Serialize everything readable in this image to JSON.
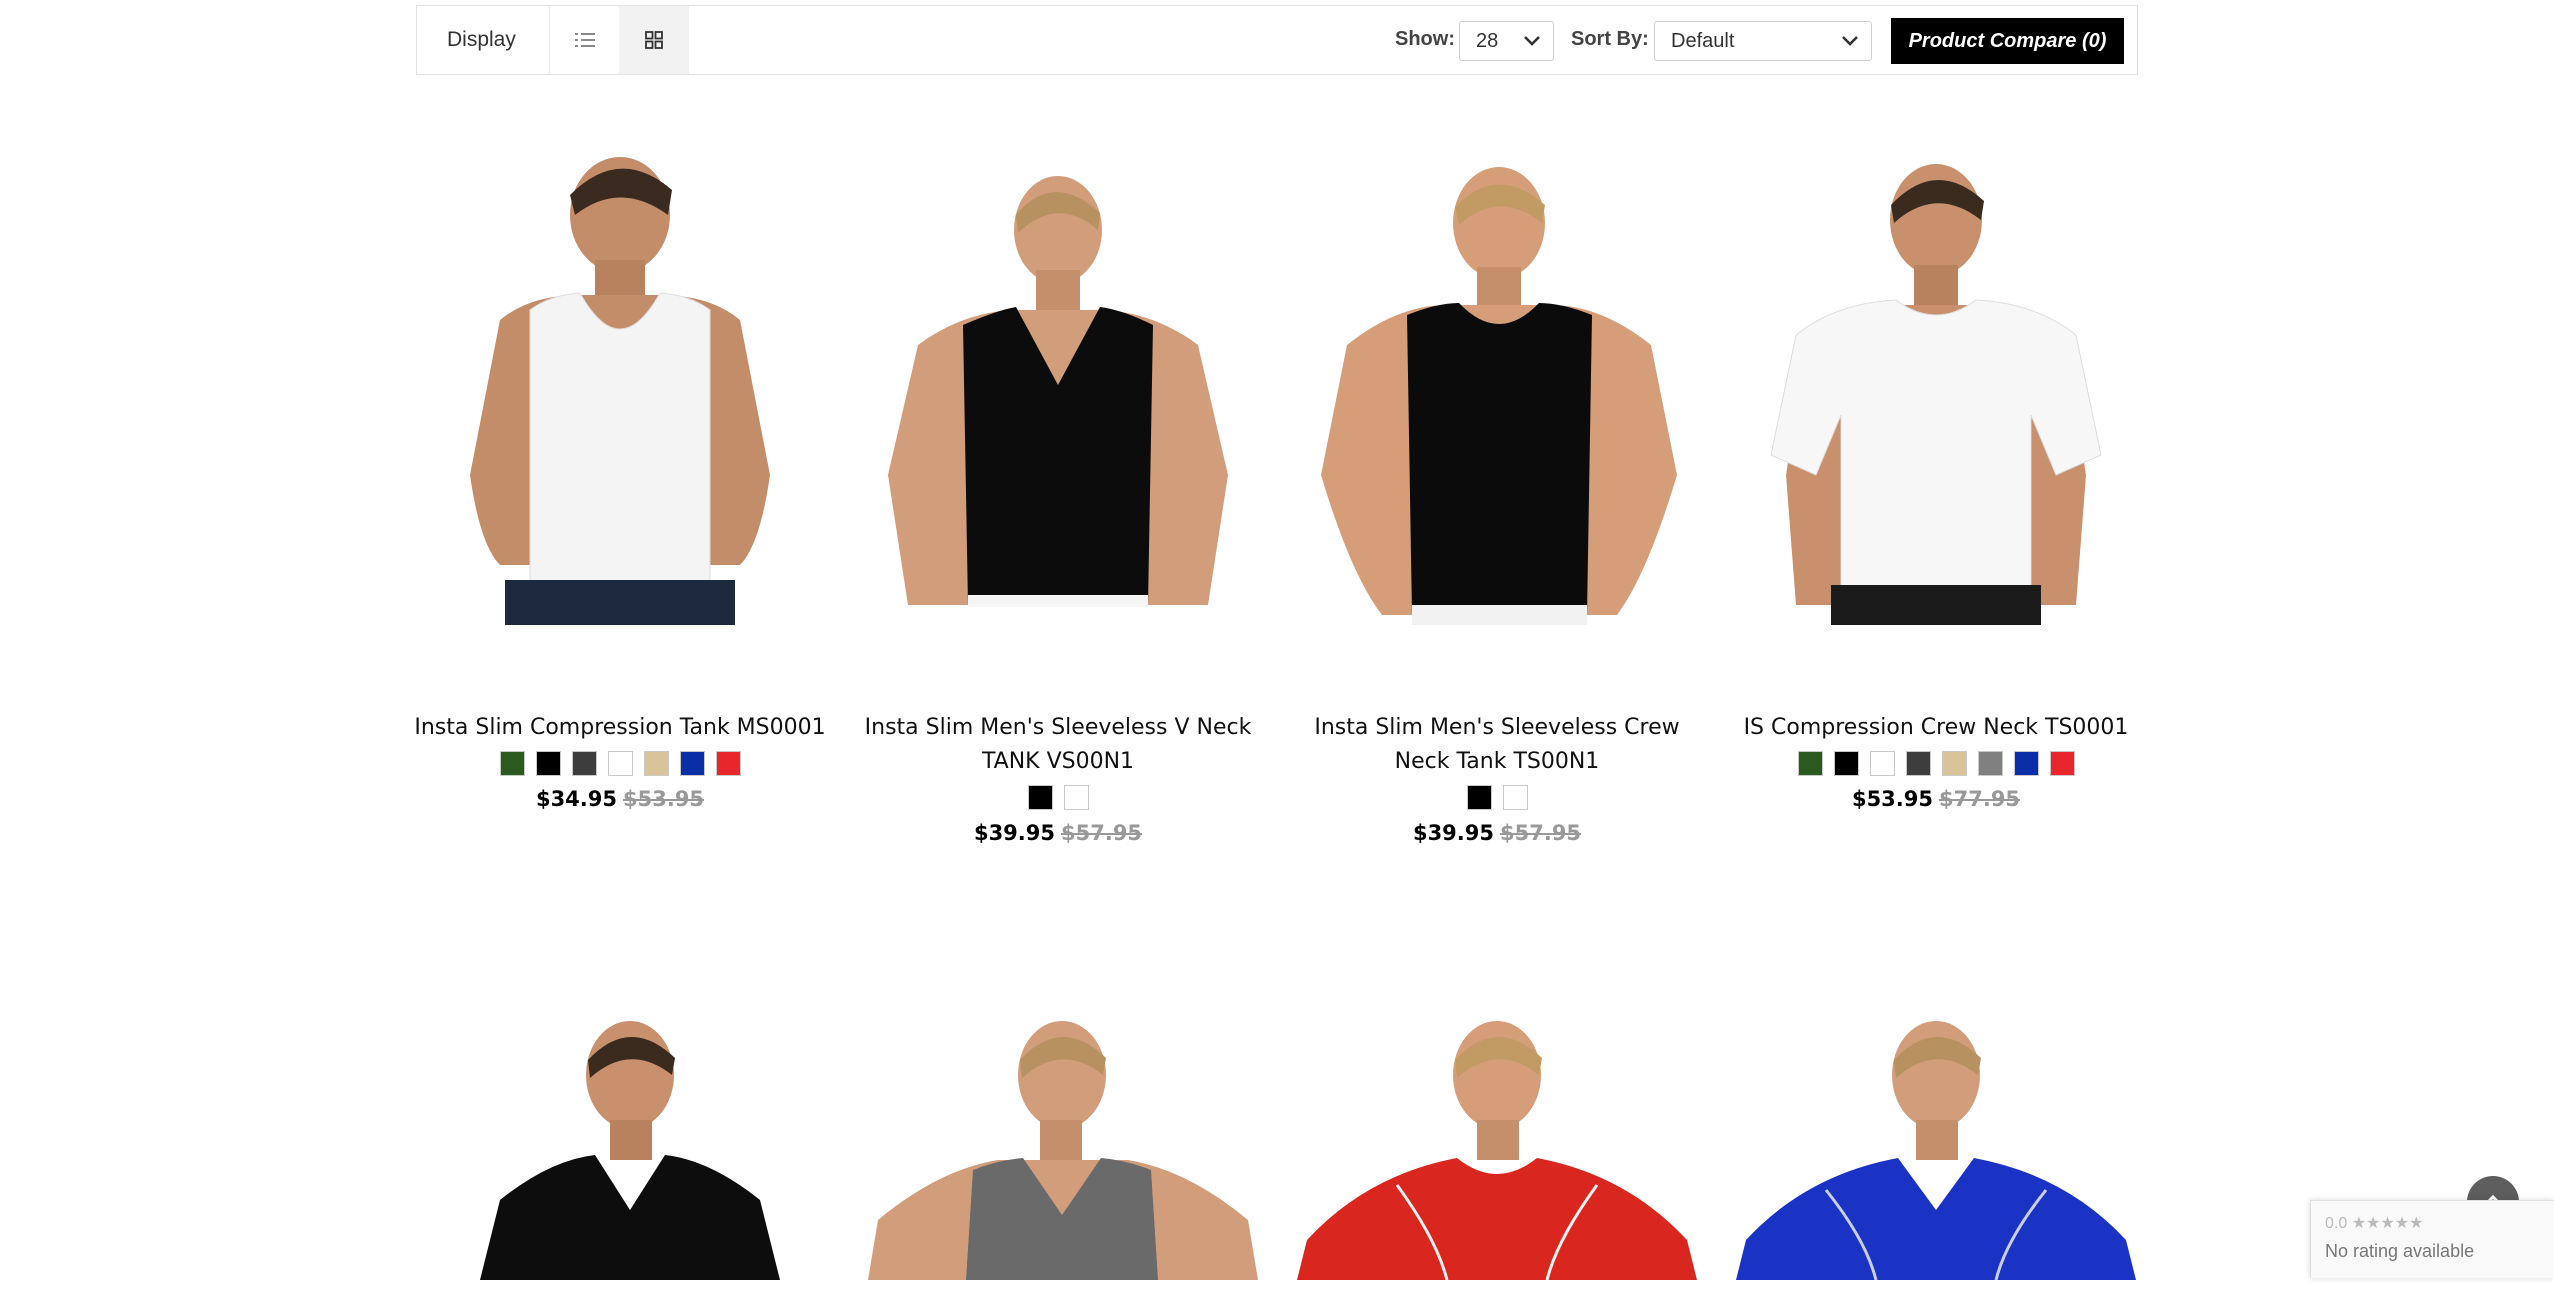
{
  "toolbar": {
    "display_label": "Display",
    "show_label": "Show:",
    "show_value": "28",
    "sort_label": "Sort By:",
    "sort_value": "Default",
    "compare_label": "Product Compare (0)"
  },
  "products": [
    {
      "name": "Insta Slim Compression Tank MS0001",
      "price": "$34.95",
      "old_price": "$53.95",
      "swatches": [
        "#2b5a1e",
        "#000000",
        "#3d3d3d",
        "#ffffff",
        "#d9c49a",
        "#0a2ea8",
        "#e8262b"
      ]
    },
    {
      "name": "Insta Slim Men's Sleeveless V Neck TANK VS00N1",
      "price": "$39.95",
      "old_price": "$57.95",
      "swatches": [
        "#000000",
        "#ffffff"
      ]
    },
    {
      "name": "Insta Slim Men's Sleeveless Crew Neck Tank TS00N1",
      "price": "$39.95",
      "old_price": "$57.95",
      "swatches": [
        "#000000",
        "#ffffff"
      ]
    },
    {
      "name": "IS Compression Crew Neck TS0001",
      "price": "$53.95",
      "old_price": "$77.95",
      "swatches": [
        "#2b5a1e",
        "#000000",
        "#ffffff",
        "#3d3d3d",
        "#d9c49a",
        "#808080",
        "#0a2ea8",
        "#e8262b"
      ]
    }
  ],
  "row2_shirt_colors": [
    "#0d0d0d",
    "#6a6a6a",
    "#d9261e",
    "#1b33c4"
  ],
  "rating_badge": {
    "stars": "0.0 ★★★★★",
    "text": "No rating available"
  }
}
